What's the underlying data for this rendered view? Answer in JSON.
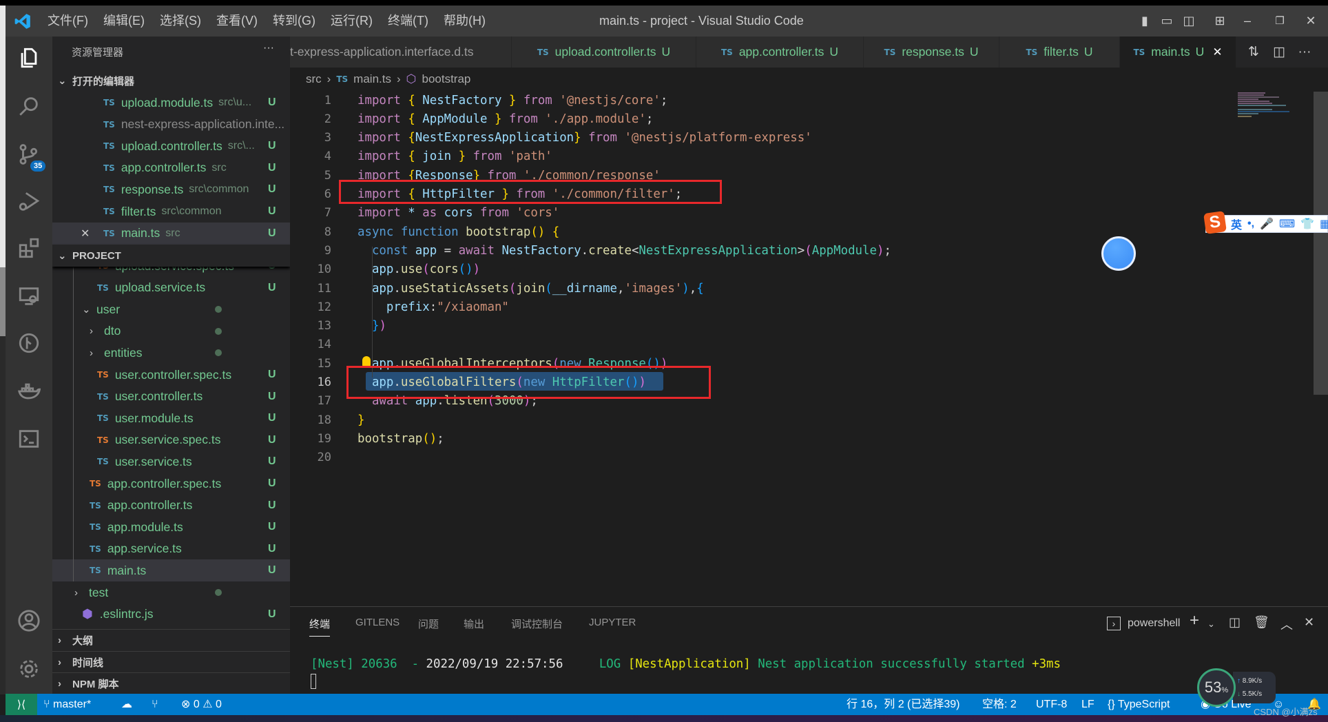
{
  "titlebar": {
    "menu": [
      "文件(F)",
      "编辑(E)",
      "选择(S)",
      "查看(V)",
      "转到(G)",
      "运行(R)",
      "终端(T)",
      "帮助(H)"
    ],
    "title": "main.ts - project - Visual Studio Code"
  },
  "activity": {
    "scm_badge": "35"
  },
  "sidebar": {
    "header": "资源管理器",
    "more": "···",
    "open_editors_title": "打开的编辑器",
    "open_editors": [
      {
        "name": "upload.module.ts",
        "desc": "src\\u...",
        "status": "U"
      },
      {
        "name": "nest-express-application.inte...",
        "desc": "",
        "status": "",
        "muted": true
      },
      {
        "name": "upload.controller.ts",
        "desc": "src\\...",
        "status": "U"
      },
      {
        "name": "app.controller.ts",
        "desc": "src",
        "status": "U"
      },
      {
        "name": "response.ts",
        "desc": "src\\common",
        "status": "U"
      },
      {
        "name": "filter.ts",
        "desc": "src\\common",
        "status": "U"
      },
      {
        "name": "main.ts",
        "desc": "src",
        "status": "U",
        "active": true
      }
    ],
    "project_title": "PROJECT",
    "tree": [
      {
        "name": "upload.service.spec.ts",
        "kind": "spec",
        "depth": 2,
        "status": "U",
        "partial": true
      },
      {
        "name": "upload.service.ts",
        "kind": "ts",
        "depth": 2,
        "status": "U"
      },
      {
        "name": "user",
        "kind": "folder-open",
        "depth": 1,
        "status": "dot"
      },
      {
        "name": "dto",
        "kind": "folder",
        "depth": 2,
        "status": "dot"
      },
      {
        "name": "entities",
        "kind": "folder",
        "depth": 2,
        "status": "dot"
      },
      {
        "name": "user.controller.spec.ts",
        "kind": "spec",
        "depth": 2,
        "status": "U"
      },
      {
        "name": "user.controller.ts",
        "kind": "ts",
        "depth": 2,
        "status": "U"
      },
      {
        "name": "user.module.ts",
        "kind": "ts",
        "depth": 2,
        "status": "U"
      },
      {
        "name": "user.service.spec.ts",
        "kind": "spec",
        "depth": 2,
        "status": "U"
      },
      {
        "name": "user.service.ts",
        "kind": "ts",
        "depth": 2,
        "status": "U"
      },
      {
        "name": "app.controller.spec.ts",
        "kind": "spec",
        "depth": 1,
        "status": "U"
      },
      {
        "name": "app.controller.ts",
        "kind": "ts",
        "depth": 1,
        "status": "U"
      },
      {
        "name": "app.module.ts",
        "kind": "ts",
        "depth": 1,
        "status": "U"
      },
      {
        "name": "app.service.ts",
        "kind": "ts",
        "depth": 1,
        "status": "U"
      },
      {
        "name": "main.ts",
        "kind": "ts",
        "depth": 1,
        "status": "U",
        "active": true
      },
      {
        "name": "test",
        "kind": "folder",
        "depth": 0,
        "status": "dot"
      },
      {
        "name": ".eslintrc.js",
        "kind": "eslint",
        "depth": 0,
        "status": "U"
      }
    ],
    "sections": [
      "大纲",
      "时间线",
      "NPM 脚本"
    ]
  },
  "tabs": [
    {
      "label": "t-express-application.interface.d.ts",
      "icon": "",
      "status": ""
    },
    {
      "label": "upload.controller.ts",
      "icon": "TS",
      "status": "U"
    },
    {
      "label": "app.controller.ts",
      "icon": "TS",
      "status": "U"
    },
    {
      "label": "response.ts",
      "icon": "TS",
      "status": "U"
    },
    {
      "label": "filter.ts",
      "icon": "TS",
      "status": "U"
    },
    {
      "label": "main.ts",
      "icon": "TS",
      "status": "U",
      "active": true,
      "close": "✕"
    }
  ],
  "breadcrumb": {
    "folder": "src",
    "file": "main.ts",
    "symbol": "bootstrap",
    "file_icon": "TS"
  },
  "editor": {
    "current_line": 16,
    "lines": [
      [
        [
          "import",
          "kw"
        ],
        [
          " ",
          "pl"
        ],
        [
          "{",
          "b1"
        ],
        [
          " NestFactory ",
          "var"
        ],
        [
          "}",
          "b1"
        ],
        [
          " from ",
          "kw"
        ],
        [
          "'@nestjs/core'",
          "str"
        ],
        [
          ";",
          "pl"
        ]
      ],
      [
        [
          "import",
          "kw"
        ],
        [
          " ",
          "pl"
        ],
        [
          "{",
          "b1"
        ],
        [
          " AppModule ",
          "var"
        ],
        [
          "}",
          "b1"
        ],
        [
          " from ",
          "kw"
        ],
        [
          "'./app.module'",
          "str"
        ],
        [
          ";",
          "pl"
        ]
      ],
      [
        [
          "import",
          "kw"
        ],
        [
          " ",
          "pl"
        ],
        [
          "{",
          "b1"
        ],
        [
          "NestExpressApplication",
          "var"
        ],
        [
          "}",
          "b1"
        ],
        [
          " from ",
          "kw"
        ],
        [
          "'@nestjs/platform-express'",
          "str"
        ]
      ],
      [
        [
          "import",
          "kw"
        ],
        [
          " ",
          "pl"
        ],
        [
          "{",
          "b1"
        ],
        [
          " join ",
          "var"
        ],
        [
          "}",
          "b1"
        ],
        [
          " from ",
          "kw"
        ],
        [
          "'path'",
          "str"
        ]
      ],
      [
        [
          "import",
          "kw"
        ],
        [
          " ",
          "pl"
        ],
        [
          "{",
          "b1"
        ],
        [
          "Response",
          "var"
        ],
        [
          "}",
          "b1"
        ],
        [
          " from ",
          "kw"
        ],
        [
          "'./common/response'",
          "str"
        ]
      ],
      [
        [
          "import",
          "kw"
        ],
        [
          " ",
          "pl"
        ],
        [
          "{",
          "b1"
        ],
        [
          " HttpFilter ",
          "var"
        ],
        [
          "}",
          "b1"
        ],
        [
          " from ",
          "kw"
        ],
        [
          "'./common/filter'",
          "str"
        ],
        [
          ";",
          "pl"
        ]
      ],
      [
        [
          "import",
          "kw"
        ],
        [
          " * ",
          "var"
        ],
        [
          "as",
          "kw"
        ],
        [
          " cors ",
          "var"
        ],
        [
          "from",
          "kw"
        ],
        [
          " ",
          "pl"
        ],
        [
          "'cors'",
          "str"
        ]
      ],
      [
        [
          "async",
          "st2"
        ],
        [
          " ",
          "pl"
        ],
        [
          "function",
          "st2"
        ],
        [
          " ",
          "pl"
        ],
        [
          "bootstrap",
          "fn"
        ],
        [
          "()",
          "b1"
        ],
        [
          " ",
          "pl"
        ],
        [
          "{",
          "b1"
        ]
      ],
      [
        [
          "  ",
          "pl"
        ],
        [
          "const",
          "st2"
        ],
        [
          " app ",
          "var"
        ],
        [
          "= ",
          "pl"
        ],
        [
          "await",
          "kw"
        ],
        [
          " NestFactory",
          "var"
        ],
        [
          ".",
          "pl"
        ],
        [
          "create",
          "fn"
        ],
        [
          "<",
          "pl"
        ],
        [
          "NestExpressApplication",
          "type"
        ],
        [
          ">",
          "pl"
        ],
        [
          "(",
          "b2"
        ],
        [
          "AppModule",
          "type"
        ],
        [
          ")",
          "b2"
        ],
        [
          ";",
          "pl"
        ]
      ],
      [
        [
          "  ",
          "pl"
        ],
        [
          "app",
          "var"
        ],
        [
          ".",
          "pl"
        ],
        [
          "use",
          "fn"
        ],
        [
          "(",
          "b2"
        ],
        [
          "cors",
          "fn"
        ],
        [
          "()",
          "b3"
        ],
        [
          ")",
          "b2"
        ]
      ],
      [
        [
          "  ",
          "pl"
        ],
        [
          "app",
          "var"
        ],
        [
          ".",
          "pl"
        ],
        [
          "useStaticAssets",
          "fn"
        ],
        [
          "(",
          "b2"
        ],
        [
          "join",
          "fn"
        ],
        [
          "(",
          "b3"
        ],
        [
          "__dirname",
          "var"
        ],
        [
          ",",
          "pl"
        ],
        [
          "'images'",
          "str"
        ],
        [
          ")",
          "b3"
        ],
        [
          ",",
          "pl"
        ],
        [
          "{",
          "b3"
        ]
      ],
      [
        [
          "    ",
          "pl"
        ],
        [
          "prefix",
          "var"
        ],
        [
          ":",
          "pl"
        ],
        [
          "\"/xiaoman\"",
          "str"
        ]
      ],
      [
        [
          "  ",
          "pl"
        ],
        [
          "}",
          "b3"
        ],
        [
          ")",
          "b2"
        ]
      ],
      [],
      [
        [
          "  ",
          "pl"
        ],
        [
          "app",
          "var"
        ],
        [
          ".",
          "pl"
        ],
        [
          "useGlobalInterceptors",
          "fn"
        ],
        [
          "(",
          "b2"
        ],
        [
          "new",
          "st2"
        ],
        [
          " ",
          "pl"
        ],
        [
          "Response",
          "type"
        ],
        [
          "()",
          "b3"
        ],
        [
          ")",
          "b2"
        ]
      ],
      [
        [
          "  ",
          "pl"
        ],
        [
          "app",
          "var"
        ],
        [
          ".",
          "pl"
        ],
        [
          "useGlobalFilters",
          "fn"
        ],
        [
          "(",
          "b2"
        ],
        [
          "new",
          "st2"
        ],
        [
          " ",
          "pl"
        ],
        [
          "HttpFilter",
          "type"
        ],
        [
          "()",
          "b3"
        ],
        [
          ")",
          "b2"
        ]
      ],
      [
        [
          "  ",
          "pl"
        ],
        [
          "await",
          "kw"
        ],
        [
          " app",
          "var"
        ],
        [
          ".",
          "pl"
        ],
        [
          "listen",
          "fn"
        ],
        [
          "(",
          "b2"
        ],
        [
          "3000",
          "num"
        ],
        [
          ")",
          "b2"
        ],
        [
          ";",
          "pl"
        ]
      ],
      [
        [
          "}",
          "b1"
        ]
      ],
      [
        [
          "bootstrap",
          "fn"
        ],
        [
          "()",
          "b1"
        ],
        [
          ";",
          "pl"
        ]
      ],
      []
    ]
  },
  "panel": {
    "tabs": [
      "终端",
      "GITLENS",
      "问题",
      "输出",
      "调试控制台",
      "JUPYTER"
    ],
    "shell": "powershell",
    "terminal": {
      "prefix": "[Nest] 20636",
      "sep": "  - ",
      "timestamp": "2022/09/19 22:57:56",
      "level": "LOG",
      "context": "[NestApplication]",
      "message": "Nest application successfully started",
      "elapsed": "+3ms"
    }
  },
  "statusbar": {
    "branch": "master*",
    "errors": "0",
    "warnings": "0",
    "position": "行 16，列 2 (已选择39)",
    "spaces": "空格: 2",
    "encoding": "UTF-8",
    "eol": "LF",
    "language": "TypeScript",
    "golive": "Go Live"
  },
  "overlays": {
    "ime_mode": "英",
    "ime_punct": "•,",
    "cpu": "53",
    "cpu_unit": "%",
    "upload": "8.9K/s",
    "download": "5.5K/s",
    "watermark": "CSDN @小满zs"
  },
  "colors": {
    "accent": "#007acc",
    "untracked": "#73c991",
    "highlight_box": "#e8282b",
    "selection": "#264f78"
  }
}
